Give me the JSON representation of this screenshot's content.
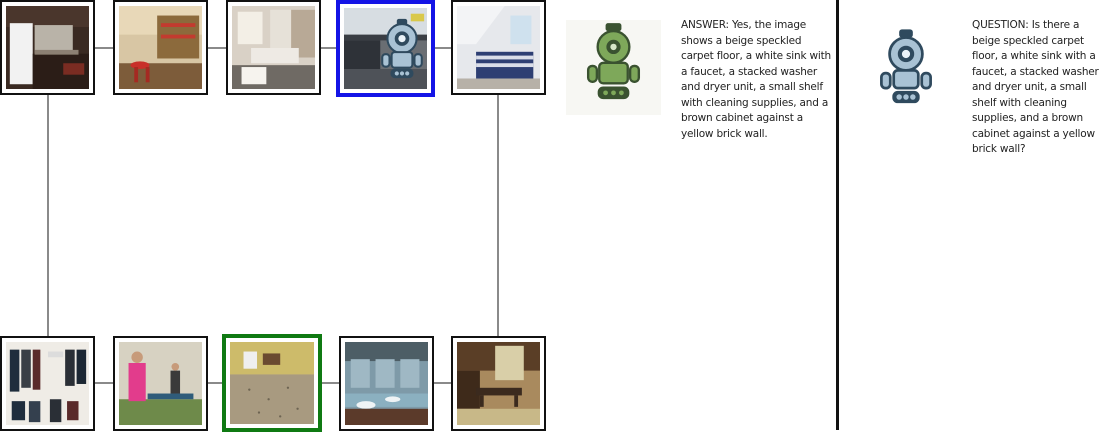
{
  "answer": {
    "text": "ANSWER: Yes, the image shows a beige speckled carpet floor, a white sink with a faucet, a stacked washer and dryer unit, a small shelf with cleaning supplies, and a brown cabinet against a yellow brick wall."
  },
  "question": {
    "text": "QUESTION: Is there a beige speckled carpet floor, a white sink with a faucet, a stacked washer and dryer unit, a small shelf with cleaning supplies, and a brown cabinet against a yellow brick wall?"
  },
  "colors": {
    "current_highlight": "#1414e6",
    "target_highlight": "#0f7a12",
    "answer_agent": "#6f9a4e",
    "question_agent": "#9cb3c6"
  },
  "graph": {
    "top_row": [
      "kitchen",
      "break-room",
      "bathroom",
      "office-with-agent",
      "bedroom"
    ],
    "bottom_row": [
      "closet",
      "ping-pong-room",
      "laundry-room-target",
      "washroom",
      "dining-room"
    ]
  }
}
